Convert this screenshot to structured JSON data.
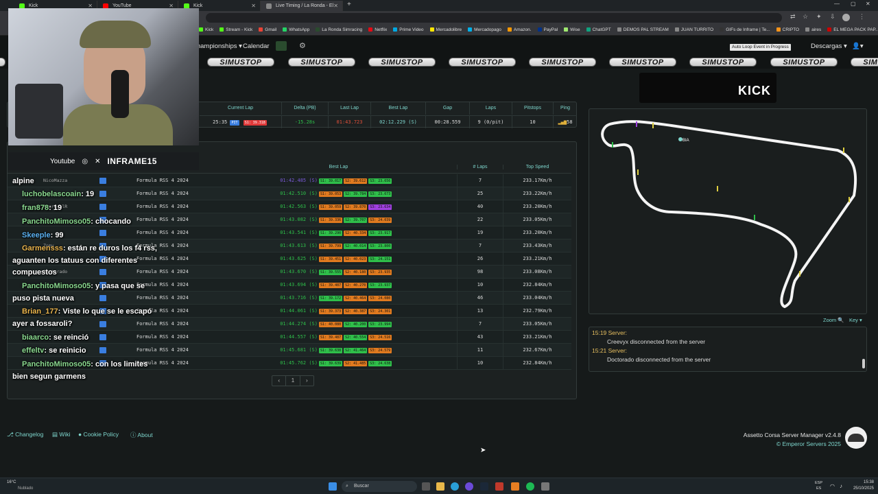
{
  "browser": {
    "tabs": [
      {
        "label": "Kick",
        "color": "#53fc18"
      },
      {
        "label": "YouTube",
        "color": "#ff0000"
      },
      {
        "label": "Kick",
        "color": "#53fc18"
      },
      {
        "label": "Live Timing / La Ronda - El Instit…",
        "color": "#888888"
      }
    ],
    "bookmarks": [
      "Kick",
      "Stream - Kick",
      "Gmail",
      "WhatsApp",
      "La Ronda Simracing",
      "Netflix",
      "Prime Video",
      "Mercadolibre",
      "Mercadopago",
      "Amazon.",
      "PayPal",
      "Wise",
      "ChatGPT",
      "DEMOS PAL STREAM",
      "JUAN TURRITO",
      "GIFs de Inframe | Te...",
      "CRIPTO",
      "aires",
      "EL MEGA PACK PAP..."
    ]
  },
  "nav": {
    "championships": "Championships",
    "calendar": "Calendar",
    "auto_loop": "Auto Loop Event in Progress",
    "downloads": "Descargas"
  },
  "sponsor": {
    "text": "SIMUSTOP"
  },
  "summary": {
    "headers": [
      "Current Lap",
      "Delta (PB)",
      "Last Lap",
      "Best Lap",
      "Gap",
      "Laps",
      "Pitstops",
      "Ping"
    ],
    "row": {
      "current_lap": "25:35",
      "pit": "PIT",
      "s1": "S1: 39.318",
      "delta": "-15.28s",
      "last_lap": "01:43.723",
      "best_lap": "02:12.229 (S)",
      "gap": "00:28.559",
      "laps": "9 (0/pit)",
      "pitstops": "10",
      "ping": "58"
    }
  },
  "leaderboard": {
    "headers": {
      "best_lap": "Best Lap",
      "laps": "# Laps",
      "top_speed": "Top Speed"
    },
    "rows": [
      {
        "driver": "NicoMazza",
        "car": "Formula RSS 4 2024",
        "best": "01:42.485 (S)",
        "s1": "S1: 39.017",
        "s2": "S2: 39.612",
        "s3": "S3: 23.656",
        "c1": "g",
        "c2": "o",
        "c3": "g",
        "laps": "7",
        "speed": "233.17Km/h"
      },
      {
        "driver": "",
        "car": "Formula RSS 4 2024",
        "best": "01:42.510 (S)",
        "s1": "S1: 39.053",
        "s2": "S2: 39.784",
        "s3": "S3: 23.673",
        "c1": "o",
        "c2": "g",
        "c3": "g",
        "laps": "25",
        "speed": "233.22Km/h"
      },
      {
        "driver": "Amaro.olR",
        "car": "Formula RSS 4 2024",
        "best": "01:42.563 (S)",
        "s1": "S1: 39.059",
        "s2": "S2: 39.870",
        "s3": "S3: 23.634",
        "c1": "o",
        "c2": "o",
        "c3": "p",
        "laps": "40",
        "speed": "233.20Km/h"
      },
      {
        "driver": "",
        "car": "Formula RSS 4 2024",
        "best": "01:43.082 (S)",
        "s1": "S1: 39.336",
        "s2": "S2: 39.707",
        "s3": "S3: 24.039",
        "c1": "o",
        "c2": "g",
        "c3": "o",
        "laps": "22",
        "speed": "233.05Km/h"
      },
      {
        "driver": "",
        "car": "Formula RSS 4 2024",
        "best": "01:43.541 (S)",
        "s1": "S1: 39.290",
        "s2": "S2: 40.334",
        "s3": "S3: 23.917",
        "c1": "g",
        "c2": "o",
        "c3": "g",
        "laps": "19",
        "speed": "233.20Km/h"
      },
      {
        "driver": "Zomy",
        "car": "Formula RSS 4 2024",
        "best": "01:43.613 (S)",
        "s1": "S1: 39.799",
        "s2": "S2: 40.014",
        "s3": "S3: 23.800",
        "c1": "o",
        "c2": "g",
        "c3": "g",
        "laps": "7",
        "speed": "233.43Km/h"
      },
      {
        "driver": "",
        "car": "Formula RSS 4 2024",
        "best": "01:43.625 (S)",
        "s1": "S1: 39.451",
        "s2": "S2: 40.023",
        "s3": "S3: 24.151",
        "c1": "o",
        "c2": "o",
        "c3": "g",
        "laps": "26",
        "speed": "233.21Km/h"
      },
      {
        "driver": "Doctorado",
        "car": "Formula RSS 4 2024",
        "best": "01:43.670 (S)",
        "s1": "S1: 39.555",
        "s2": "S2: 40.180",
        "s3": "S3: 23.935",
        "c1": "g",
        "c2": "o",
        "c3": "o",
        "laps": "98",
        "speed": "233.08Km/h"
      },
      {
        "driver": "",
        "car": "Formula RSS 4 2024",
        "best": "01:43.694 (S)",
        "s1": "S1: 39.487",
        "s2": "S2: 40.270",
        "s3": "S3: 23.937",
        "c1": "o",
        "c2": "o",
        "c3": "g",
        "laps": "10",
        "speed": "232.84Km/h"
      },
      {
        "driver": "",
        "car": "Formula RSS 4 2024",
        "best": "01:43.716 (S)",
        "s1": "S1: 39.172",
        "s2": "S2: 40.464",
        "s3": "S3: 24.080",
        "c1": "g",
        "c2": "o",
        "c3": "o",
        "laps": "46",
        "speed": "233.04Km/h"
      },
      {
        "driver": "",
        "car": "Formula RSS 4 2024",
        "best": "01:44.061 (S)",
        "s1": "S1: 39.373",
        "s2": "S2: 40.387",
        "s3": "S3: 24.301",
        "c1": "o",
        "c2": "o",
        "c3": "o",
        "laps": "13",
        "speed": "232.79Km/h"
      },
      {
        "driver": "",
        "car": "Formula RSS 4 2024",
        "best": "01:44.274 (S)",
        "s1": "S1: 40.080",
        "s2": "S2: 40.200",
        "s3": "S3: 23.994",
        "c1": "o",
        "c2": "g",
        "c3": "g",
        "laps": "7",
        "speed": "233.05Km/h"
      },
      {
        "driver": "",
        "car": "Formula RSS 4 2024",
        "best": "01:44.557 (S)",
        "s1": "S1: 39.487",
        "s2": "S2: 40.554",
        "s3": "S3: 24.516",
        "c1": "o",
        "c2": "g",
        "c3": "o",
        "laps": "43",
        "speed": "233.21Km/h"
      },
      {
        "driver": "",
        "car": "Formula RSS 4 2024",
        "best": "01:45.681 (S)",
        "s1": "S1: 39.638",
        "s2": "S2: 41.464",
        "s3": "S3: 24.579",
        "c1": "g",
        "c2": "g",
        "c3": "o",
        "laps": "11",
        "speed": "232.67Km/h"
      },
      {
        "driver": "",
        "car": "Formula RSS 4 2024",
        "best": "01:45.762 (S)",
        "s1": "S1: 39.639",
        "s2": "S2: 41.485",
        "s3": "S3: 24.638",
        "c1": "g",
        "c2": "o",
        "c3": "g",
        "laps": "10",
        "speed": "232.84Km/h"
      }
    ],
    "pagination": {
      "prev": "‹",
      "page": "1",
      "next": "›"
    }
  },
  "webcam": {
    "youtube": "Youtube",
    "handle": "INFRAME15"
  },
  "chat": [
    {
      "user": "",
      "text": "alpine"
    },
    {
      "user": "luchobelascoain",
      "text": ": 19"
    },
    {
      "user": "fran878",
      "text": ": 19"
    },
    {
      "user": "PanchitoMimoso05",
      "text": ": chocando"
    },
    {
      "user": "Skeeple",
      "text": ": 99"
    },
    {
      "user": "Garmensss",
      "text": ": están re duros los f4 rss,"
    },
    {
      "user": "",
      "text": "aguanten los tatuus con diferentes"
    },
    {
      "user": "",
      "text": "compuestos"
    },
    {
      "user": "PanchitoMimoso05",
      "text": ": y pasa que se"
    },
    {
      "user": "",
      "text": "puso pista nueva"
    },
    {
      "user": "Brian_177",
      "text": ": Viste lo que se le escapó"
    },
    {
      "user": "",
      "text": "ayer a fossaroli?"
    },
    {
      "user": "biaarco",
      "text": ": se reinció"
    },
    {
      "user": "effeltv",
      "text": ": se reinicio"
    },
    {
      "user": "PanchitoMimoso05",
      "text": ": con los limites"
    },
    {
      "user": "",
      "text": "bien segun garmens"
    }
  ],
  "map": {
    "kick_label": "KICK",
    "marker_label": "BIA",
    "zoom": "Zoom",
    "key": "Key"
  },
  "log": [
    {
      "time": "15:19 Server:",
      "msg": "Creevyx disconnected from the server"
    },
    {
      "time": "15:21 Server:",
      "msg": "Doctorado disconnected from the server"
    }
  ],
  "footer": {
    "links": [
      "Changelog",
      "Wiki",
      "Cookie Policy",
      "About"
    ],
    "brand": "Assetto Corsa Server Manager v2.4.8",
    "copyright": "© Emperor Servers 2025"
  },
  "taskbar": {
    "weather_temp": "16°C",
    "weather_desc": "Nublado",
    "search": "Buscar",
    "lang1": "ESP",
    "lang2": "ES",
    "time": "15:38",
    "date": "25/10/2025"
  },
  "colors": {
    "accent": "#7ed6cd",
    "panel": "#1c2121",
    "kick_green": "#53fc18"
  }
}
